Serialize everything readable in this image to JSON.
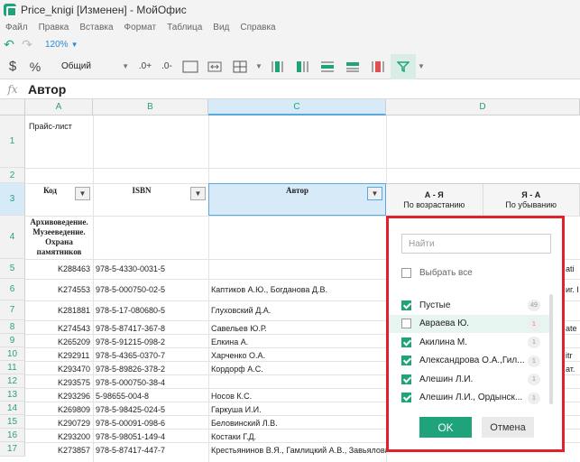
{
  "window": {
    "title": "Price_knigi [Изменен] - МойОфис"
  },
  "menu": [
    "Файл",
    "Правка",
    "Вставка",
    "Формат",
    "Таблица",
    "Вид",
    "Справка"
  ],
  "quick": {
    "zoom": "120%"
  },
  "toolbar": {
    "currency_icon": "$",
    "percent_icon": "%",
    "format_value": "Общий",
    "increase_decimals": ".0+",
    "decrease_decimals": ".0-"
  },
  "formula_bar": {
    "fx_label": "fx",
    "value": "Автор"
  },
  "columns": [
    "A",
    "B",
    "C",
    "D"
  ],
  "rows": [
    "1",
    "2",
    "3",
    "4",
    "5",
    "6",
    "7",
    "8",
    "9",
    "10",
    "11",
    "12",
    "13",
    "14",
    "15",
    "16",
    "17"
  ],
  "cells": {
    "a1": "Прайс-лист",
    "hdr_code": "Код",
    "hdr_isbn": "ISBN",
    "hdr_author": "Автор",
    "a4": [
      "Архивоведение.",
      "Музееведение.",
      "Охрана",
      "памятников"
    ]
  },
  "table_rows": [
    {
      "code": "K288463",
      "isbn": "978-5-4330-0031-5",
      "author": ""
    },
    {
      "code": "K274553",
      "isbn": "978-5-000750-02-5",
      "author": "Каптиков А.Ю., Богданова Д.В."
    },
    {
      "code": "K281881",
      "isbn": "978-5-17-080680-5",
      "author": "Глуховский Д.А."
    },
    {
      "code": "K274543",
      "isbn": "978-5-87417-367-8",
      "author": "Савельев Ю.Р."
    },
    {
      "code": "K265209",
      "isbn": "978-5-91215-098-2",
      "author": "Елкина А."
    },
    {
      "code": "K292911",
      "isbn": "978-5-4365-0370-7",
      "author": "Харченко О.А."
    },
    {
      "code": "K293470",
      "isbn": "978-5-89826-378-2",
      "author": "Кордорф А.С."
    },
    {
      "code": "K293575",
      "isbn": "978-5-000750-38-4",
      "author": ""
    },
    {
      "code": "K293296",
      "isbn": "5-98655-004-8",
      "author": "Носов К.С."
    },
    {
      "code": "K269809",
      "isbn": "978-5-98425-024-5",
      "author": "Гаркуша И.И."
    },
    {
      "code": "K290729",
      "isbn": "978-5-00091-098-6",
      "author": "Беловинский Л.В."
    },
    {
      "code": "K293200",
      "isbn": "978-5-98051-149-4",
      "author": "Костаки Г.Д."
    },
    {
      "code": "K273857",
      "isbn": "978-5-87417-447-7",
      "author": "Крестьянинов В.Я., Гамлицкий А.В., Завьялова"
    }
  ],
  "d_partial": [
    "ati",
    "иг. I",
    "",
    "ate",
    "",
    "itr",
    "ат.",
    "",
    "",
    "",
    "",
    "",
    ""
  ],
  "sort": {
    "asc_title": "А - Я",
    "asc_sub": "По возрастанию",
    "desc_title": "Я - А",
    "desc_sub": "По убыванию"
  },
  "filter": {
    "search_placeholder": "Найти",
    "select_all": "Выбрать все",
    "items": [
      {
        "label": "Пустые",
        "count": "49"
      },
      {
        "label": "Авраева Ю.",
        "count": "1"
      },
      {
        "label": "Акилина М.",
        "count": "1"
      },
      {
        "label": "Александрова О.А.,Гил...",
        "count": "1"
      },
      {
        "label": "Алешин Л.И.",
        "count": "1"
      },
      {
        "label": "Алешин Л.И., Ордынск...",
        "count": "1"
      }
    ],
    "ok": "OK",
    "cancel": "Отмена"
  },
  "colors": {
    "accent": "#1fa37a",
    "highlight": "#e0202a",
    "selection": "#d6eaf8"
  }
}
